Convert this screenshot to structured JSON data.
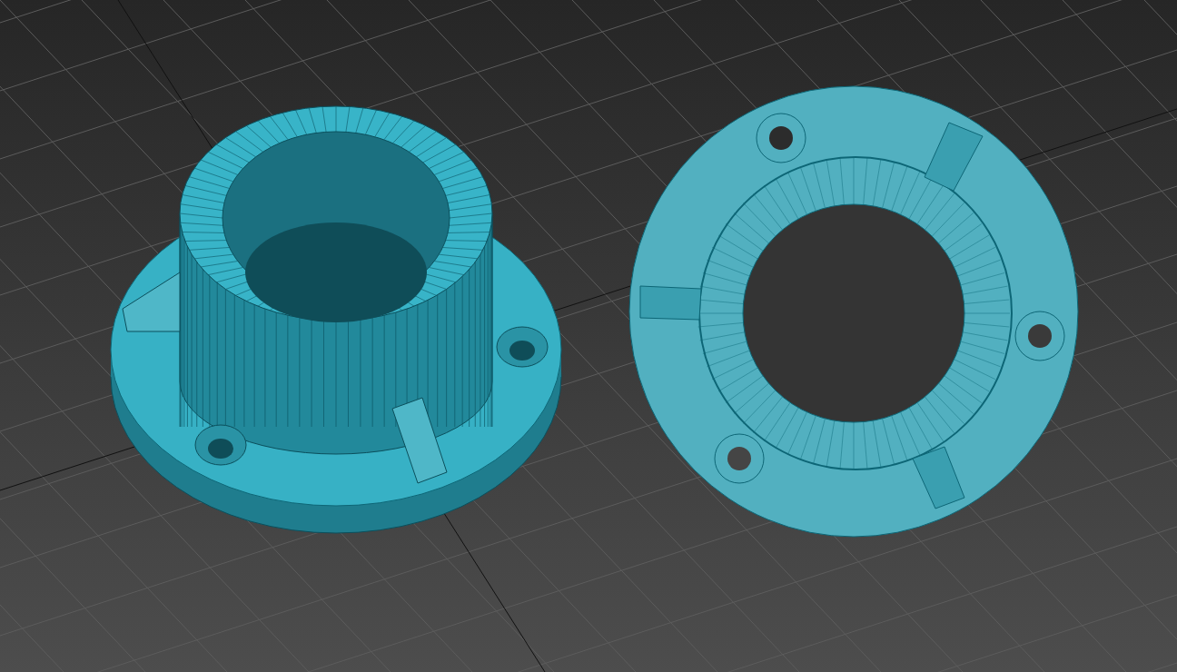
{
  "viewport": {
    "objects": [
      {
        "kind": "flange-top"
      },
      {
        "kind": "flange-bottom"
      }
    ]
  }
}
